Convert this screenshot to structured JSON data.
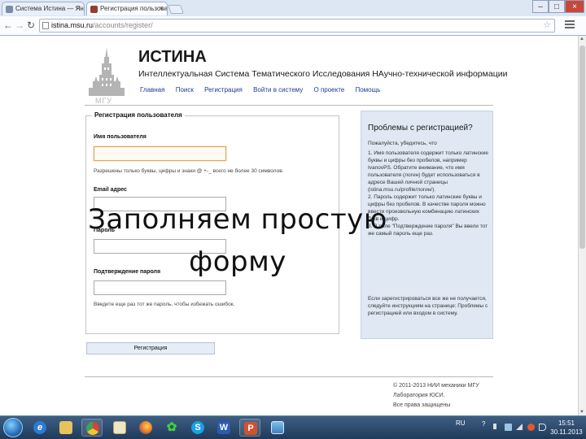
{
  "browser": {
    "tabs": [
      {
        "title": "Система Истина — Яндекс",
        "active": false
      },
      {
        "title": "Регистрация пользовате",
        "active": true
      }
    ],
    "tab_close_glyph": "×",
    "window_controls": {
      "minimize": "–",
      "maximize": "□",
      "close": "×"
    },
    "url_host": "istina.msu.ru",
    "url_path": "/accounts/register/",
    "nav": {
      "back": "←",
      "forward": "→",
      "reload": "↻"
    }
  },
  "site": {
    "logo_caption": "МГУ",
    "title": "ИСТИНА",
    "subtitle": "Интеллектуальная Система Тематического Исследования НАучно-технической информации",
    "menu": [
      "Главная",
      "Поиск",
      "Регистрация",
      "Войти в систему",
      "О проекте",
      "Помощь"
    ]
  },
  "form": {
    "legend": "Регистрация пользователя",
    "username_label": "Имя пользователя",
    "username_hint": "Разрешены только буквы, цифры и знаки @ +-_ всего не более 30 символов.",
    "email_label": "Email адрес",
    "password_label": "Пароль",
    "confirm_label": "Подтверждение пароля",
    "confirm_hint": "Введите еще раз тот же пароль, чтобы избежать ошибок.",
    "submit_label": "Регистрация"
  },
  "help": {
    "title": "Проблемы с регистрацией?",
    "intro": "Пожалуйста, убедитесь, что",
    "items": [
      "1. Имя пользователя содержит только латинские буквы и цифры без пробелов, например IvanovPS. Обратите внимание, что имя пользователя (логин) будет использоваться в адресе Вашей личной страницы (istina.msu.ru/profile/логин/).",
      "2. Пароль содержит только латинские буквы и цифры без пробелов. В качестве пароля можно ввести произвольную комбинацию латинских букв и цифр.",
      "3. В поле \"Подтверждение пароля\" Вы ввели тот же самый пароль еще раз."
    ],
    "outro": "Если зарегистрироваться все же не получается, следуйте инструкциям на странице: Проблемы с регистрацией или входом в систему."
  },
  "footer": {
    "lines": [
      "© 2011-2013 НИИ механики МГУ",
      "Лаборатория ЮСИ.",
      "Все права защищены"
    ]
  },
  "overlay": {
    "caption": "Заполняем простую форму"
  },
  "taskbar": {
    "language": "RU",
    "clock_time": "15:51",
    "clock_date": "30.11.2013"
  }
}
